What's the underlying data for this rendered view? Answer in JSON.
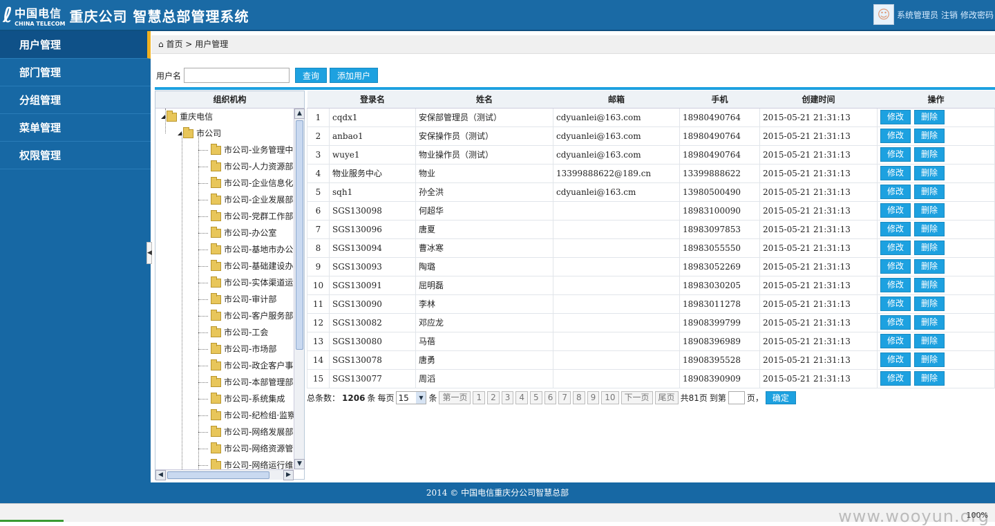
{
  "header": {
    "logo_mark": "ℓ",
    "logo_cn": "中国电信",
    "logo_en": "CHINA TELECOM",
    "system_title": "重庆公司 智慧总部管理系统",
    "user_name": "系统管理员",
    "logout": "注销",
    "change_password": "修改密码"
  },
  "sidebar": {
    "items": [
      {
        "label": "用户管理"
      },
      {
        "label": "部门管理"
      },
      {
        "label": "分组管理"
      },
      {
        "label": "菜单管理"
      },
      {
        "label": "权限管理"
      }
    ]
  },
  "breadcrumb": {
    "home": "首页",
    "sep": ">",
    "current": "用户管理"
  },
  "search": {
    "label": "用户名",
    "value": "",
    "query_btn": "查询",
    "add_btn": "添加用户"
  },
  "tree": {
    "header": "组织机构",
    "root": "重庆电信",
    "branch": "市公司",
    "leaves": [
      "市公司-业务管理中",
      "市公司-人力资源部",
      "市公司-企业信息化",
      "市公司-企业发展部",
      "市公司-党群工作部",
      "市公司-办公室",
      "市公司-基地市办公",
      "市公司-基础建设办",
      "市公司-实体渠道运",
      "市公司-审计部",
      "市公司-客户服务部",
      "市公司-工会",
      "市公司-市场部",
      "市公司-政企客户事",
      "市公司-本部管理部",
      "市公司-系统集成",
      "市公司-纪检组·监察",
      "市公司-网络发展部",
      "市公司-网络资源管",
      "市公司-网络运行维"
    ]
  },
  "table": {
    "headers": [
      "",
      "登录名",
      "姓名",
      "邮箱",
      "手机",
      "创建时间",
      "操作"
    ],
    "edit_label": "修改",
    "delete_label": "删除",
    "rows": [
      {
        "no": "1",
        "login": "cqdx1",
        "name": "安保部管理员（测试）",
        "email": "cdyuanlei@163.com",
        "phone": "18980490764",
        "created": "2015-05-21 21:31:13"
      },
      {
        "no": "2",
        "login": "anbao1",
        "name": "安保操作员（测试）",
        "email": "cdyuanlei@163.com",
        "phone": "18980490764",
        "created": "2015-05-21 21:31:13"
      },
      {
        "no": "3",
        "login": "wuye1",
        "name": "物业操作员（测试）",
        "email": "cdyuanlei@163.com",
        "phone": "18980490764",
        "created": "2015-05-21 21:31:13"
      },
      {
        "no": "4",
        "login": "物业服务中心",
        "name": "物业",
        "email": "13399888622@189.cn",
        "phone": "13399888622",
        "created": "2015-05-21 21:31:13"
      },
      {
        "no": "5",
        "login": "sqh1",
        "name": "孙全洪",
        "email": "cdyuanlei@163.cm",
        "phone": "13980500490",
        "created": "2015-05-21 21:31:13"
      },
      {
        "no": "6",
        "login": "SGS130098",
        "name": "何超华",
        "email": "",
        "phone": "18983100090",
        "created": "2015-05-21 21:31:13"
      },
      {
        "no": "7",
        "login": "SGS130096",
        "name": "唐夏",
        "email": "",
        "phone": "18983097853",
        "created": "2015-05-21 21:31:13"
      },
      {
        "no": "8",
        "login": "SGS130094",
        "name": "曹冰寒",
        "email": "",
        "phone": "18983055550",
        "created": "2015-05-21 21:31:13"
      },
      {
        "no": "9",
        "login": "SGS130093",
        "name": "陶璐",
        "email": "",
        "phone": "18983052269",
        "created": "2015-05-21 21:31:13"
      },
      {
        "no": "10",
        "login": "SGS130091",
        "name": "屈明磊",
        "email": "",
        "phone": "18983030205",
        "created": "2015-05-21 21:31:13"
      },
      {
        "no": "11",
        "login": "SGS130090",
        "name": "李林",
        "email": "",
        "phone": "18983011278",
        "created": "2015-05-21 21:31:13"
      },
      {
        "no": "12",
        "login": "SGS130082",
        "name": "邓应龙",
        "email": "",
        "phone": "18908399799",
        "created": "2015-05-21 21:31:13"
      },
      {
        "no": "13",
        "login": "SGS130080",
        "name": "马蓓",
        "email": "",
        "phone": "18908396989",
        "created": "2015-05-21 21:31:13"
      },
      {
        "no": "14",
        "login": "SGS130078",
        "name": "唐勇",
        "email": "",
        "phone": "18908395528",
        "created": "2015-05-21 21:31:13"
      },
      {
        "no": "15",
        "login": "SGS130077",
        "name": "周滔",
        "email": "",
        "phone": "18908390909",
        "created": "2015-05-21 21:31:13"
      }
    ]
  },
  "pager": {
    "total_label": "总条数：",
    "total": "1206",
    "unit": "条",
    "per_page_label": "每页",
    "per_page": "15",
    "first": "第一页",
    "pages": [
      "1",
      "2",
      "3",
      "4",
      "5",
      "6",
      "7",
      "8",
      "9",
      "10"
    ],
    "next": "下一页",
    "last": "尾页",
    "total_pages": "共81页",
    "goto_label": "到第",
    "goto_suffix": "页，",
    "confirm": "确定"
  },
  "footer": {
    "text": "2014 © 中国电信重庆分公司智慧总部"
  },
  "statusbar": {
    "watermark": "www.wooyun.org",
    "zoom": "100%"
  },
  "colors": {
    "brand_blue": "#1768a4",
    "button_blue": "#1da1e0",
    "active_accent": "#f0b020"
  }
}
